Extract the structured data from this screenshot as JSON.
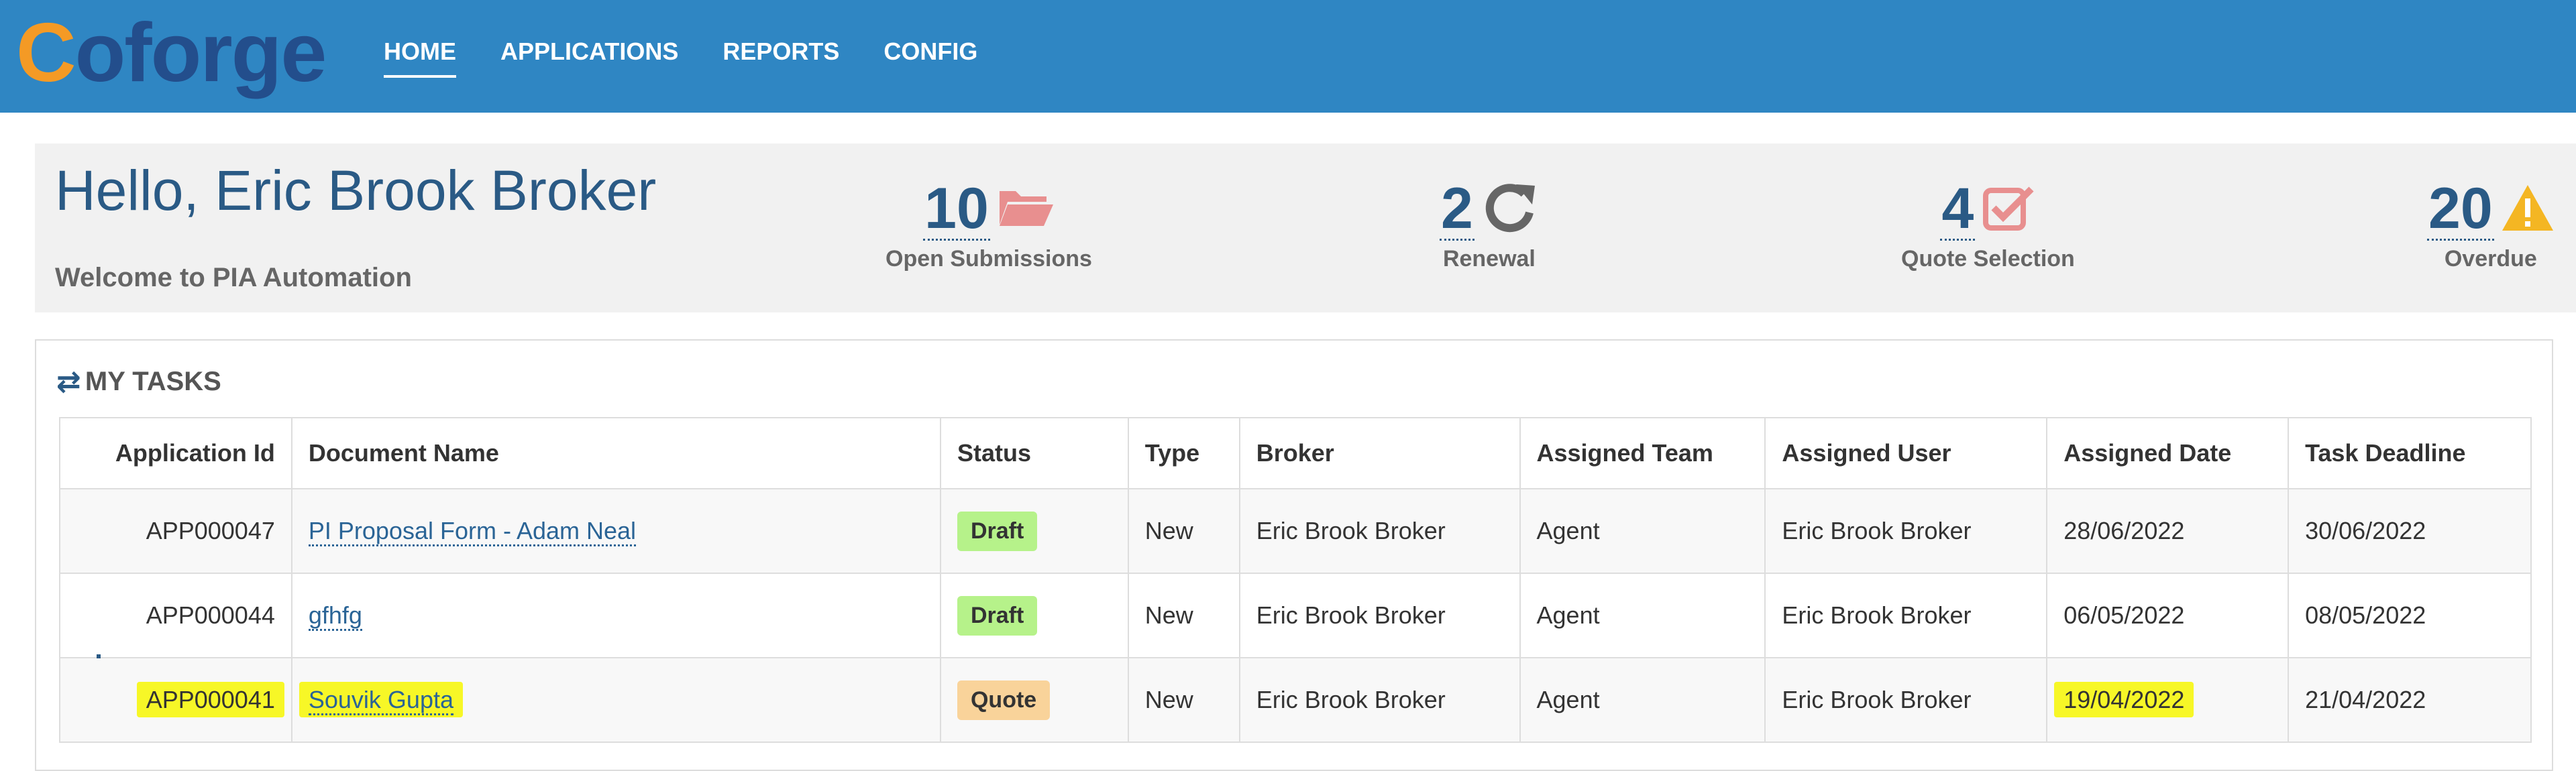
{
  "logo": {
    "c": "C",
    "rest": "oforge"
  },
  "nav": [
    {
      "label": "HOME",
      "active": true
    },
    {
      "label": "APPLICATIONS"
    },
    {
      "label": "REPORTS"
    },
    {
      "label": "CONFIG"
    }
  ],
  "hero": {
    "greeting": "Hello, Eric Brook Broker",
    "subtitle": "Welcome to PIA Automation"
  },
  "stats": [
    {
      "value": "10",
      "label": "Open Submissions",
      "icon": "folder-open-icon",
      "color": "#e88f8f"
    },
    {
      "value": "2",
      "label": "Renewal",
      "icon": "refresh-icon",
      "color": "#666666"
    },
    {
      "value": "4",
      "label": "Quote Selection",
      "icon": "check-square-icon",
      "color": "#e88f8f"
    },
    {
      "value": "20",
      "label": "Overdue",
      "icon": "warning-icon",
      "color": "#f4b623"
    }
  ],
  "tasks": {
    "title": "MY TASKS",
    "icon": "exchange-icon",
    "columns": [
      "Application Id",
      "Document Name",
      "Status",
      "Type",
      "Broker",
      "Assigned Team",
      "Assigned User",
      "Assigned Date",
      "Task Deadline"
    ],
    "rows": [
      {
        "app_id": "APP000047",
        "doc": "PI Proposal Form - Adam Neal",
        "status": "Draft",
        "type": "New",
        "broker": "Eric Brook Broker",
        "team": "Agent",
        "user": "Eric Brook Broker",
        "assigned": "28/06/2022",
        "deadline": "30/06/2022"
      },
      {
        "app_id": "APP000044",
        "doc": "gfhfg",
        "status": "Draft",
        "type": "New",
        "broker": "Eric Brook Broker",
        "team": "Agent",
        "user": "Eric Brook Broker",
        "assigned": "06/05/2022",
        "deadline": "08/05/2022"
      },
      {
        "app_id": "APP000041",
        "doc": "Souvik Gupta",
        "status": "Quote",
        "type": "New",
        "broker": "Eric Brook Broker",
        "team": "Agent",
        "user": "Eric Brook Broker",
        "assigned": "19/04/2022",
        "deadline": "21/04/2022"
      }
    ]
  },
  "colors": {
    "header": "#2f86c3",
    "accent": "#2a5a85",
    "highlight": "#f7f727",
    "draft": "#b6f28a",
    "quote": "#f9d39a"
  }
}
